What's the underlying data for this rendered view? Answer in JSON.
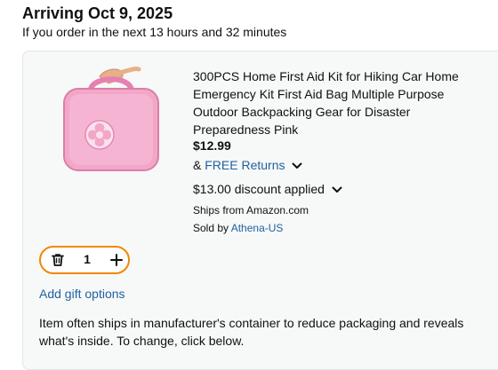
{
  "delivery": {
    "heading": "Arriving Oct 9, 2025",
    "order_within": "If you order in the next 13 hours and 32 minutes"
  },
  "item": {
    "title": "300PCS Home First Aid Kit for Hiking Car Home Emergency Kit First Aid Bag Multiple Purpose Outdoor Backpacking Gear for Disaster Preparedness Pink",
    "price": "$12.99",
    "returns_prefix": "&",
    "returns_link": "FREE Returns",
    "discount": "$13.00 discount applied",
    "ships_from": "Ships from Amazon.com",
    "sold_by_prefix": "Sold by",
    "seller": "Athena-US",
    "image_icon": "pink-first-aid-bag"
  },
  "quantity": {
    "value": "1",
    "delete_icon": "trash-icon",
    "increment_icon": "plus-icon"
  },
  "gift_options": "Add gift options",
  "packaging_note": "Item often ships in manufacturer's container to reduce packaging and reveals what's inside. To change, click below.",
  "colors": {
    "link": "#2162A1",
    "qty_border": "#F08804",
    "card_bg": "#F7F8F8",
    "product_pink": "#F2A7C9"
  }
}
